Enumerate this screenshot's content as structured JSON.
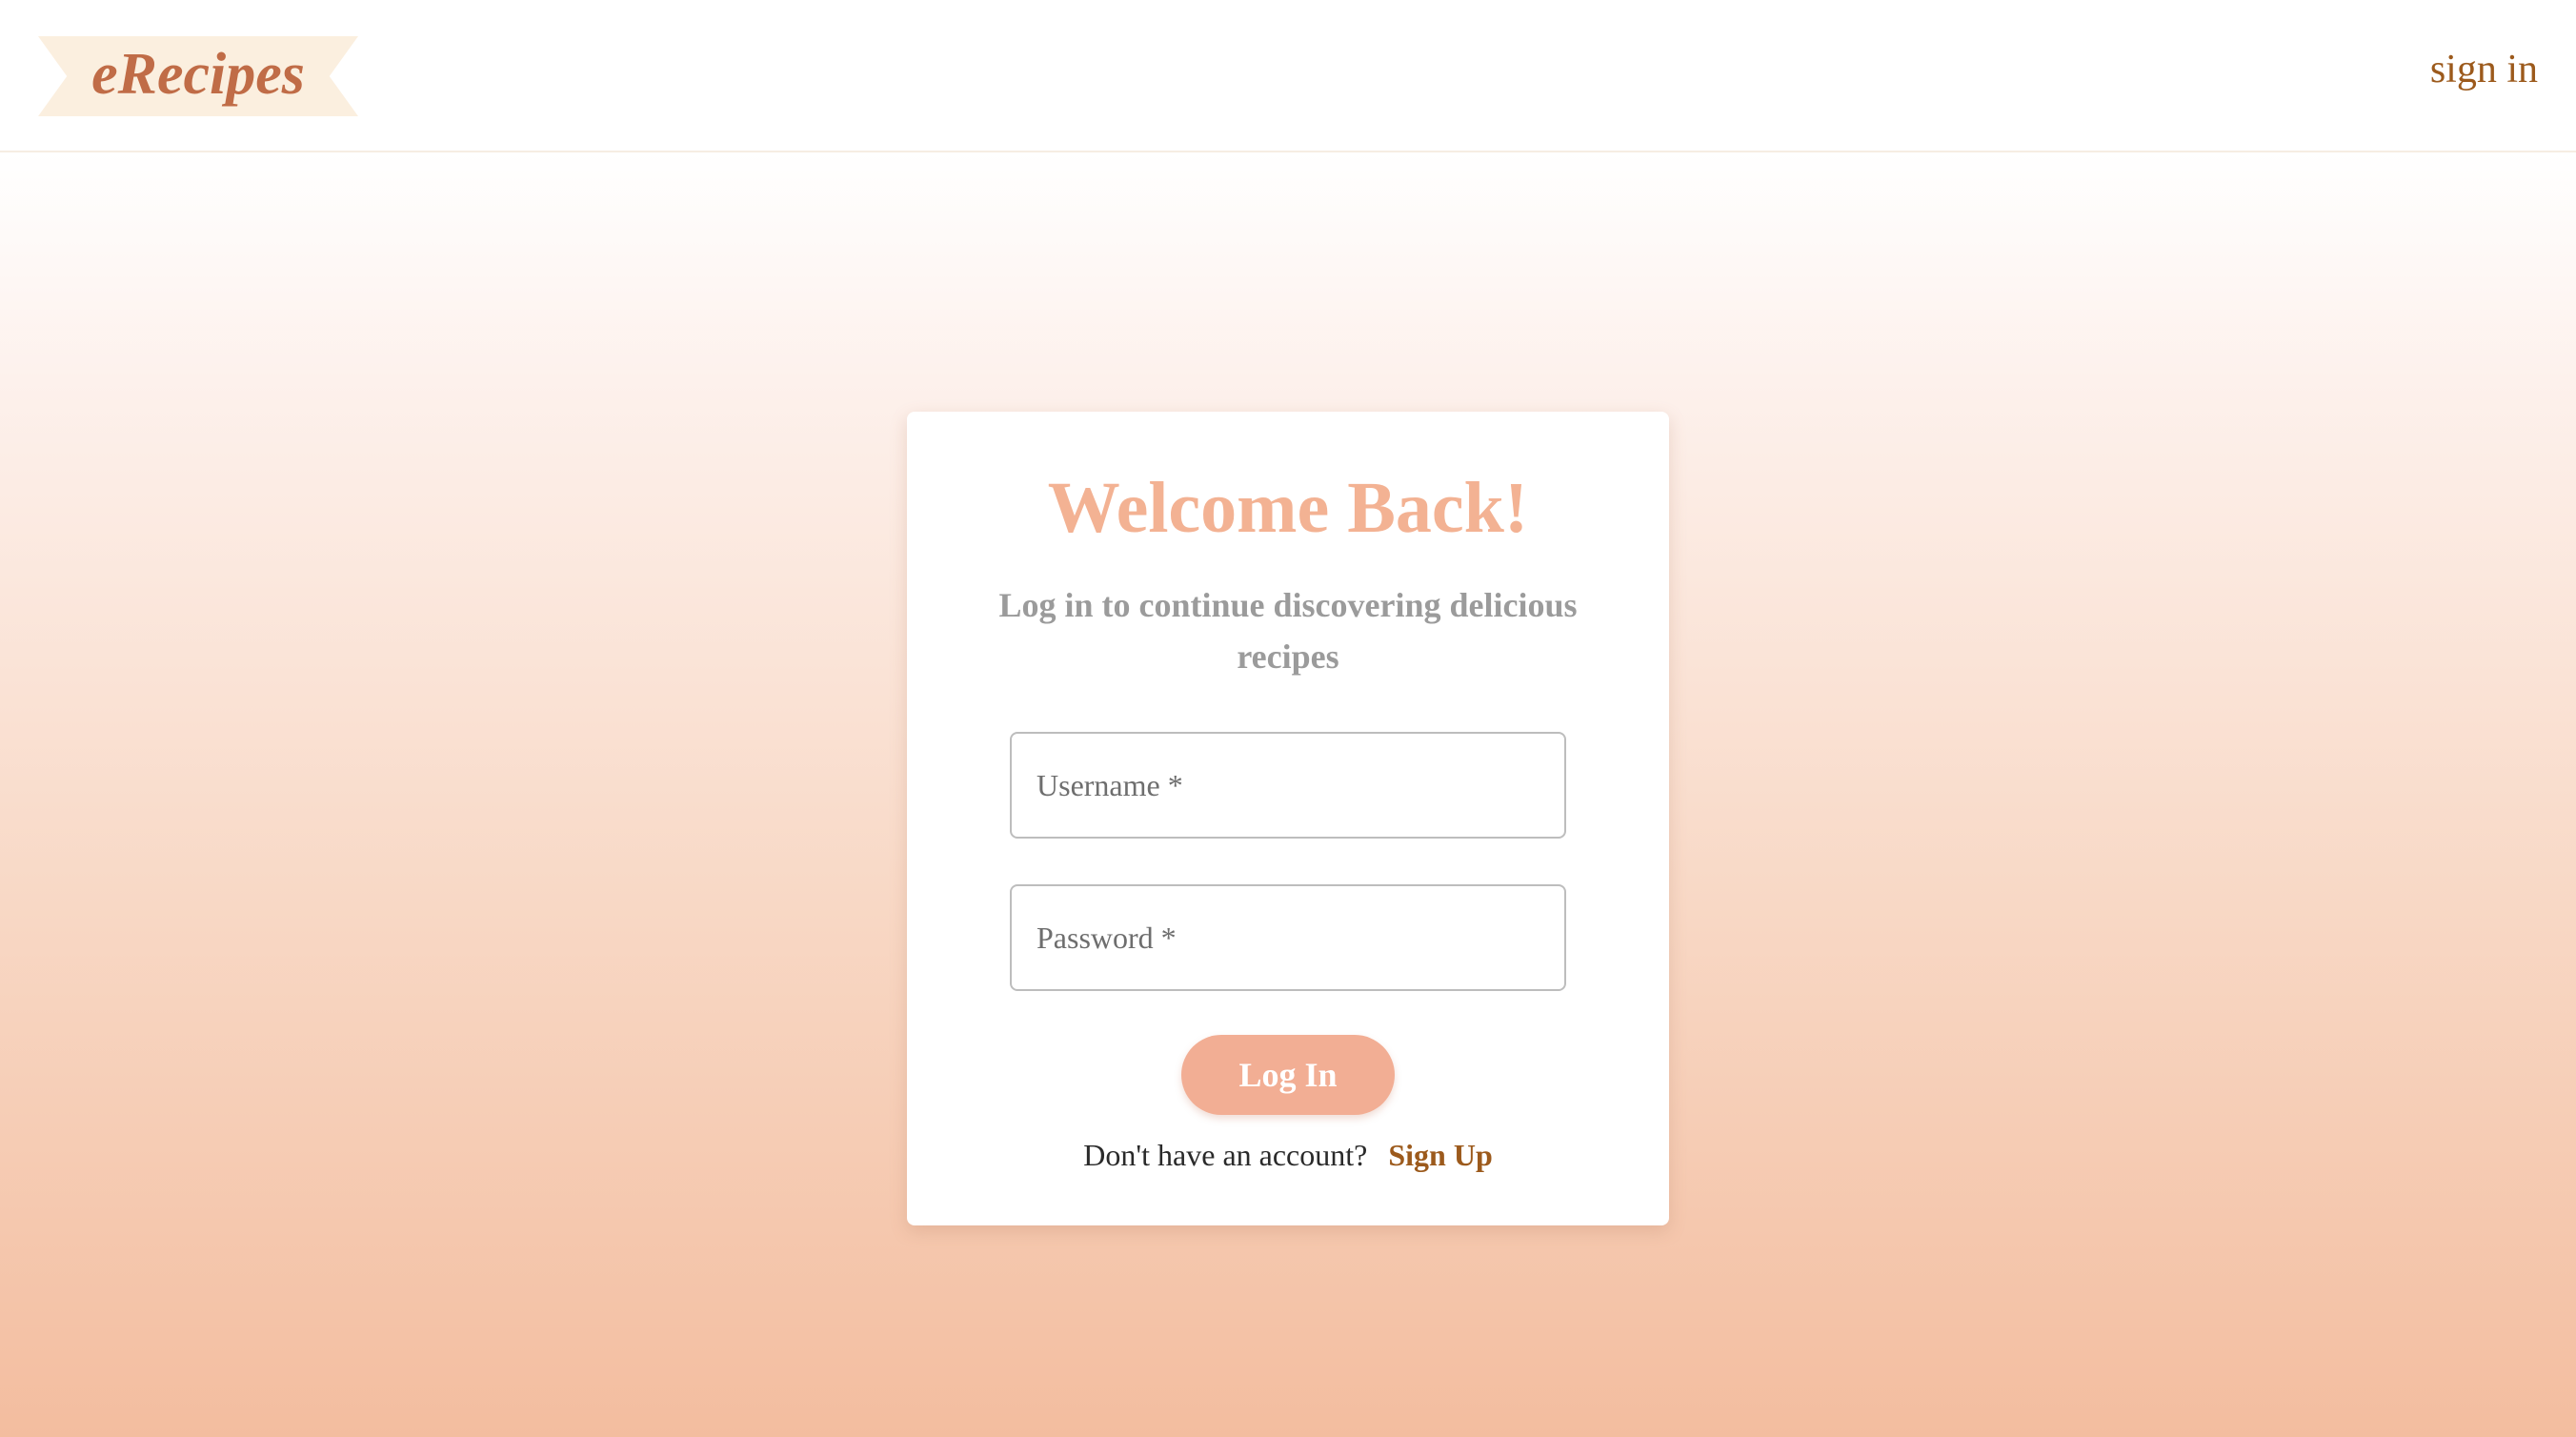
{
  "header": {
    "logo_text": "eRecipes",
    "signin_label": "sign in"
  },
  "login_card": {
    "title": "Welcome Back!",
    "subtitle": "Log in to continue discovering delicious recipes",
    "username_placeholder": "Username *",
    "username_value": "",
    "password_placeholder": "Password *",
    "password_value": "",
    "login_button_label": "Log In",
    "signup_prompt": "Don't have an account?",
    "signup_link_label": "Sign Up"
  },
  "colors": {
    "accent": "#f2ae94",
    "title": "#f3b293",
    "link": "#9c5a1c",
    "logo": "#c06c47",
    "logo_bg": "#fbefdf"
  }
}
